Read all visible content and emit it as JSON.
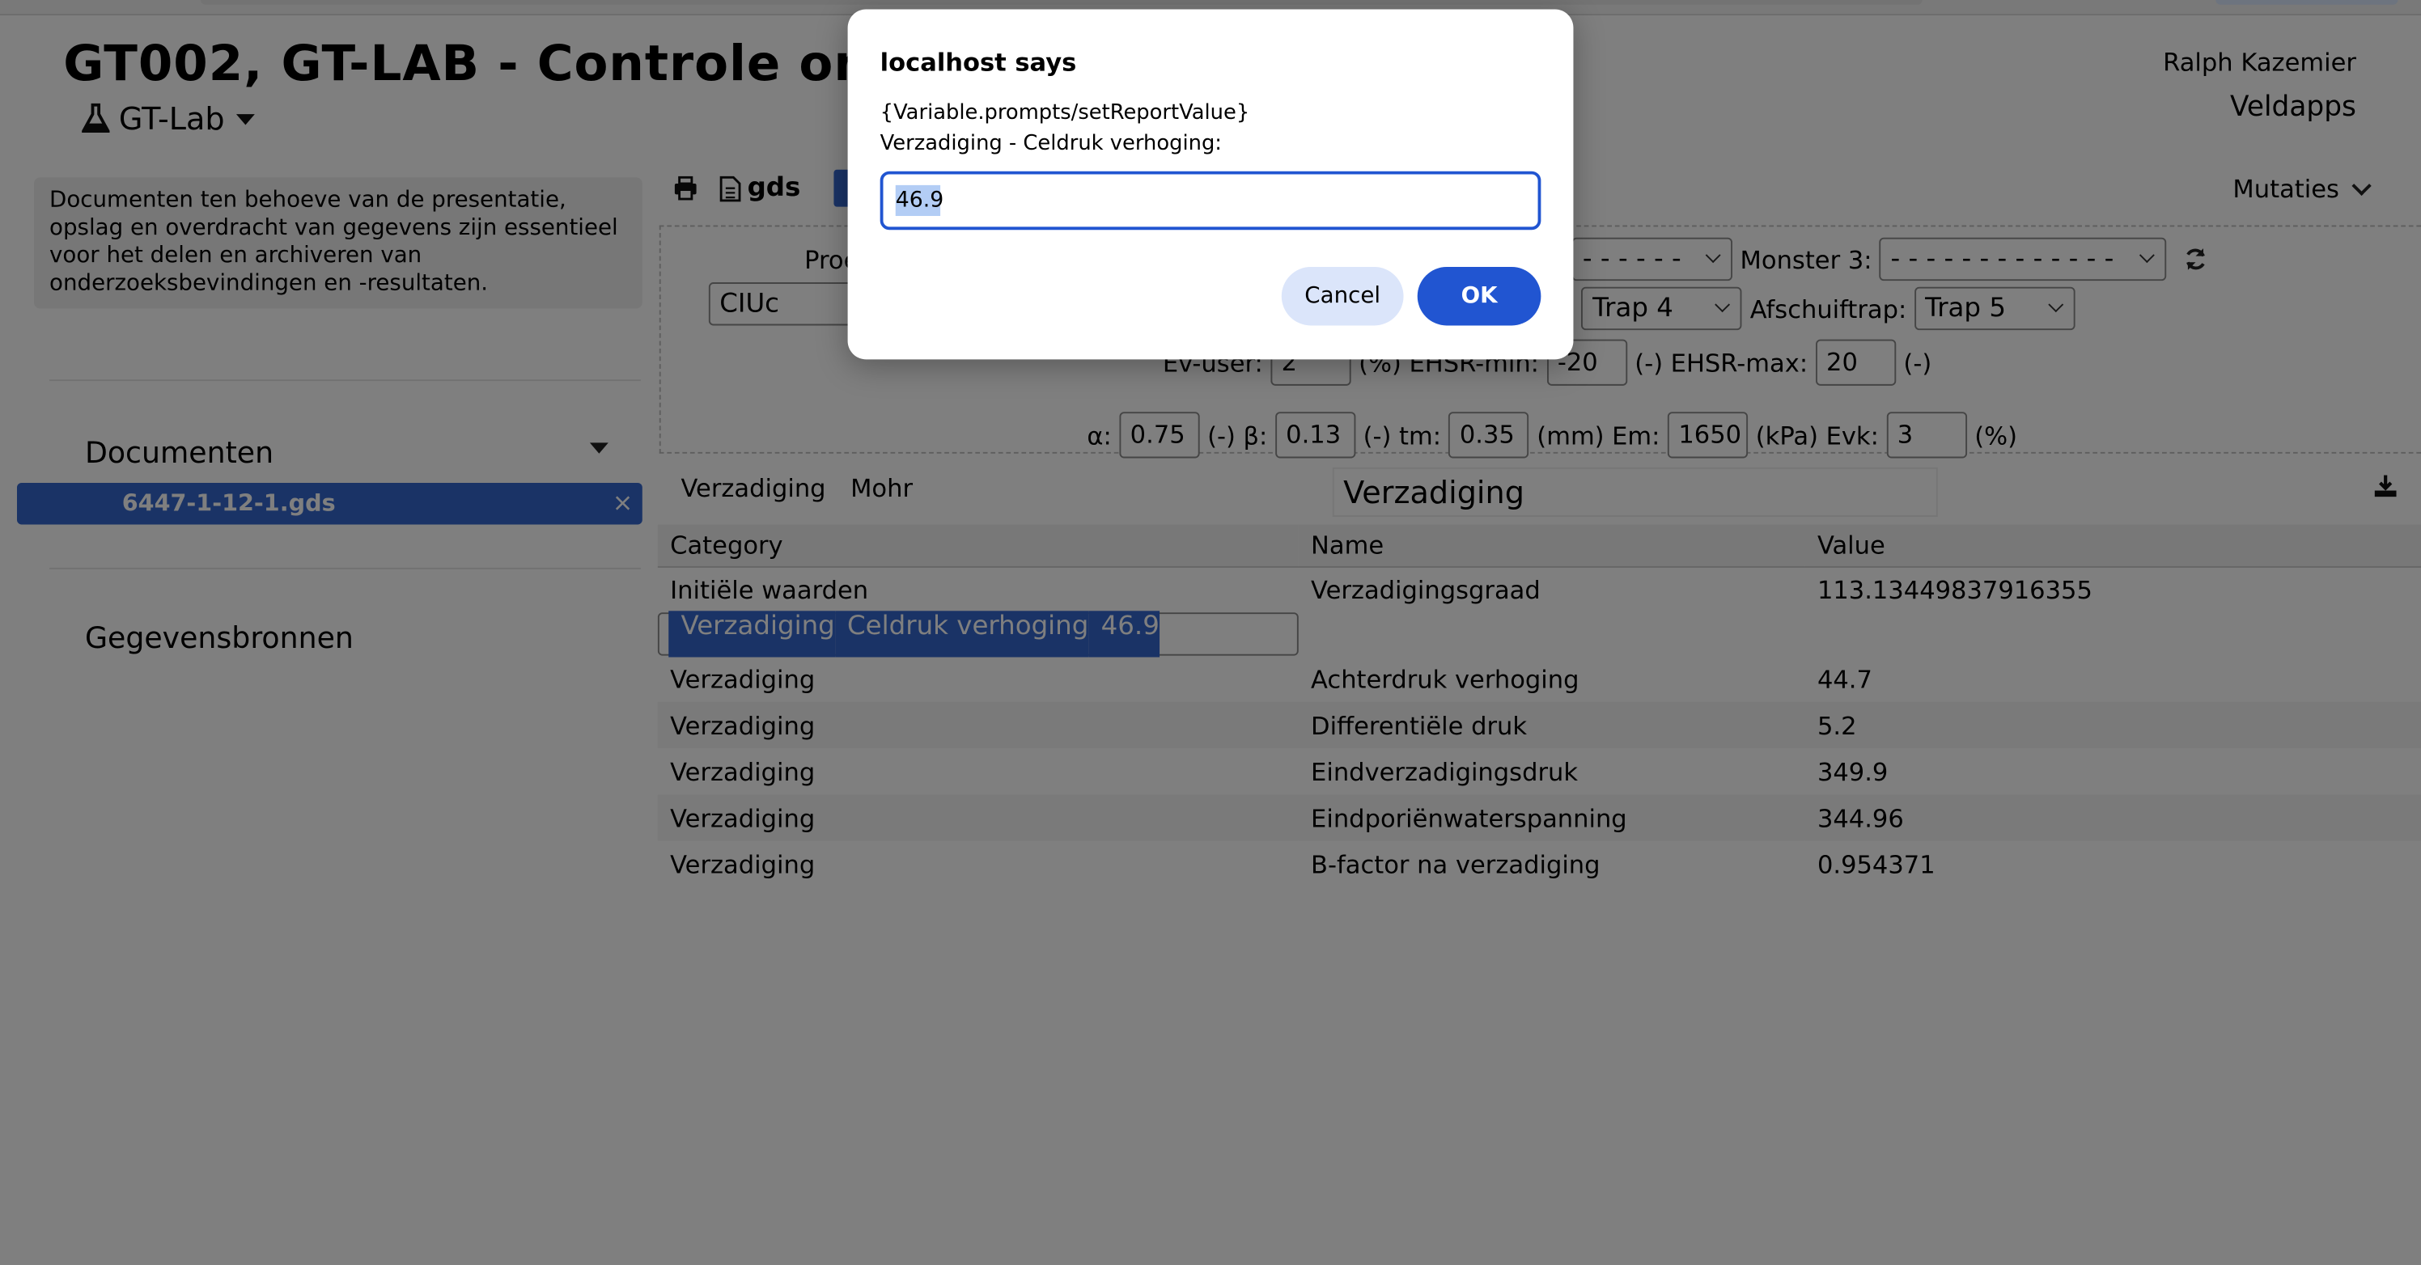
{
  "app": {
    "title": "GT002, GT-LAB - Controle onder",
    "lab_menu": "GT-Lab",
    "user": "Ralph Kazemier",
    "veldapps": "Veldapps"
  },
  "sidebar": {
    "info": "Documenten ten behoeve van de presentatie, opslag en overdracht van gegevens zijn essentieel voor het delen en archiveren van onderzoeksbevindingen en -resultaten.",
    "documents_title": "Documenten",
    "document_item": "6447-1-12-1.gds",
    "close_symbol": "×",
    "sources_title": "Gegevensbronnen"
  },
  "toolbar": {
    "gds_label": "gds",
    "mutaties_label": "Mutaties"
  },
  "params": {
    "proef_label": "Proe",
    "proef_value": "CIUc",
    "monster2_value": "- - - - - -",
    "monster3_label": "Monster 3:",
    "monster3_value": "- - - - - - - - - - - - -",
    "trap_label_fragment": ":",
    "trap_value": "Trap 4",
    "afschuiftrap_label": "Afschuiftrap:",
    "afschuiftrap_value": "Trap 5",
    "ev_user_label": "Ev-user:",
    "ev_user_value": "2",
    "ev_user_unit": "(%)",
    "ehsr_min_label": "EHSR-min:",
    "ehsr_min_value": "-20",
    "ehsr_min_unit": "(-)",
    "ehsr_max_label": "EHSR-max:",
    "ehsr_max_value": "20",
    "ehsr_max_unit": "(-)",
    "alpha_label": "α:",
    "alpha_value": "0.75",
    "alpha_unit": "(-)",
    "beta_label": "β:",
    "beta_value": "0.13",
    "beta_unit": "(-)",
    "tm_label": "tm:",
    "tm_value": "0.35",
    "tm_unit": "(mm)",
    "em_label": "Em:",
    "em_value": "1650",
    "em_unit": "(kPa)",
    "evk_label": "Evk:",
    "evk_value": "3",
    "evk_unit": "(%)"
  },
  "view": {
    "tabs": [
      "Verzadiging",
      "Mohr"
    ],
    "title": "Verzadiging"
  },
  "table": {
    "headers": [
      "Category",
      "Name",
      "Value"
    ],
    "rows": [
      [
        "Initiële waarden",
        "Verzadigingsgraad",
        "113.13449837916355"
      ],
      [
        "Verzadiging",
        "Celdruk verhoging",
        "46.9"
      ],
      [
        "Verzadiging",
        "Achterdruk verhoging",
        "44.7"
      ],
      [
        "Verzadiging",
        "Differentiële druk",
        "5.2"
      ],
      [
        "Verzadiging",
        "Eindverzadigingsdruk",
        "349.9"
      ],
      [
        "Verzadiging",
        "Eindporiënwaterspanning",
        "344.96"
      ],
      [
        "Verzadiging",
        "B-factor na verzadiging",
        "0.954371"
      ]
    ]
  },
  "dialog": {
    "title": "localhost says",
    "line1": "{Variable.prompts/setReportValue}",
    "line2": "Verzadiging - Celdruk verhoging:",
    "input_value": "46.9",
    "cancel_label": "Cancel",
    "ok_label": "OK"
  },
  "colors": {
    "accent": "#3466cc",
    "dialog_button": "#2155d1",
    "overlay": "rgba(0,0,0,0.5)"
  }
}
